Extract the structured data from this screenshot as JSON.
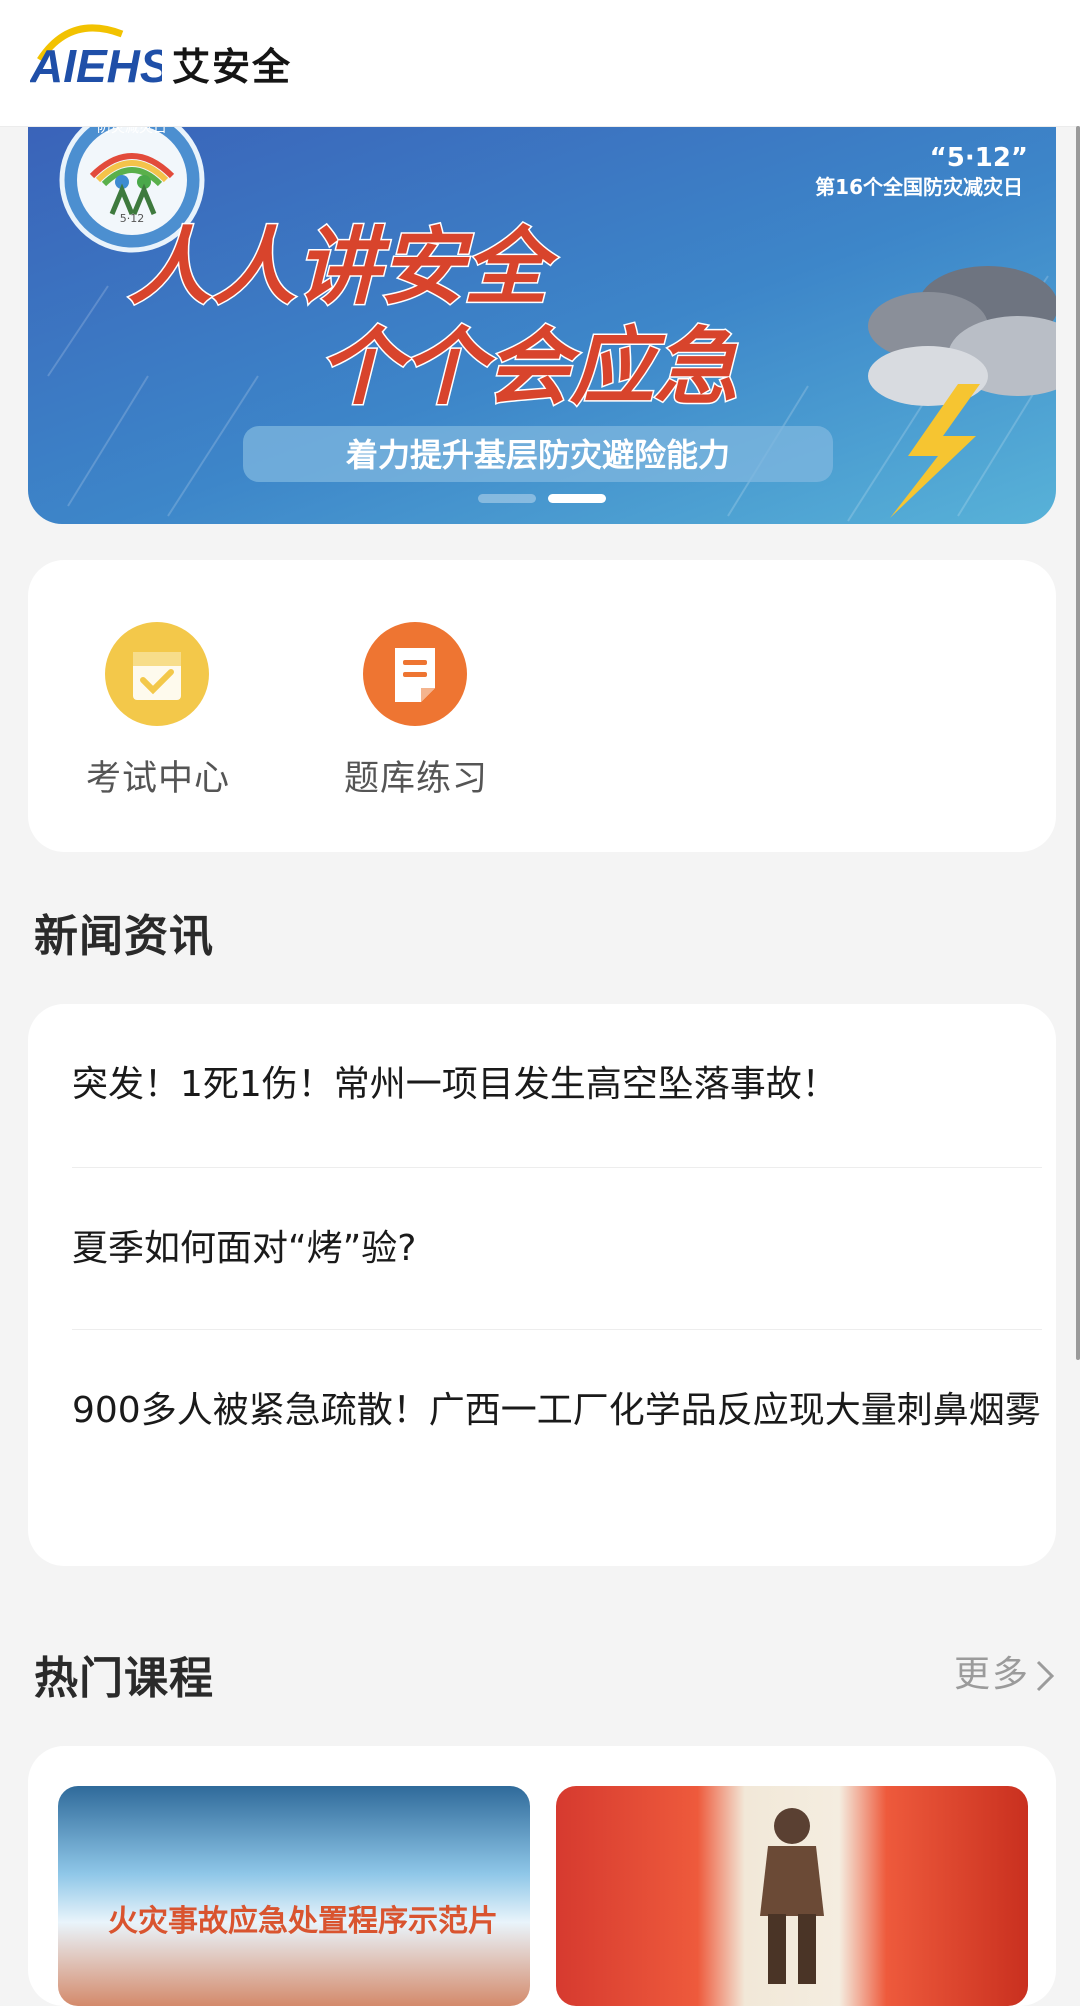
{
  "app": {
    "logo_text": "AIEHS",
    "title": "艾安全",
    "brand_yellow": "#F2C200",
    "brand_blue": "#1F4FA8"
  },
  "banner": {
    "badge_text": "防灾减灾日",
    "badge_date": "5·12",
    "corner_title": "“5·12”",
    "corner_subtitle": "第16个全国防灾减灾日",
    "headline_1": "人人讲安全",
    "headline_2": "个个会应急",
    "slogan": "着力提升基层防灾避险能力",
    "slide_count": 2,
    "active_slide": 2
  },
  "quick_actions": [
    {
      "label": "考试中心",
      "icon": "exam-clipboard-icon",
      "color": "#F3C84A"
    },
    {
      "label": "题库练习",
      "icon": "question-bank-document-icon",
      "color": "#EE7532"
    }
  ],
  "news": {
    "title": "新闻资讯",
    "items": [
      "突发！1死1伤！常州一项目发生高空坠落事故！",
      "夏季如何面对“烤”验?",
      "900多人被紧急疏散！广西一工厂化学品反应现大量刺鼻烟雾"
    ]
  },
  "courses": {
    "title": "热门课程",
    "more_label": "更多",
    "more_icon": "chevron-right-icon",
    "items": [
      {
        "caption": "火灾事故应急处置程序示范片",
        "thumb": "fire-emergency-thumbnail"
      },
      {
        "caption": "",
        "thumb": "firefighter-thumbnail"
      }
    ]
  }
}
